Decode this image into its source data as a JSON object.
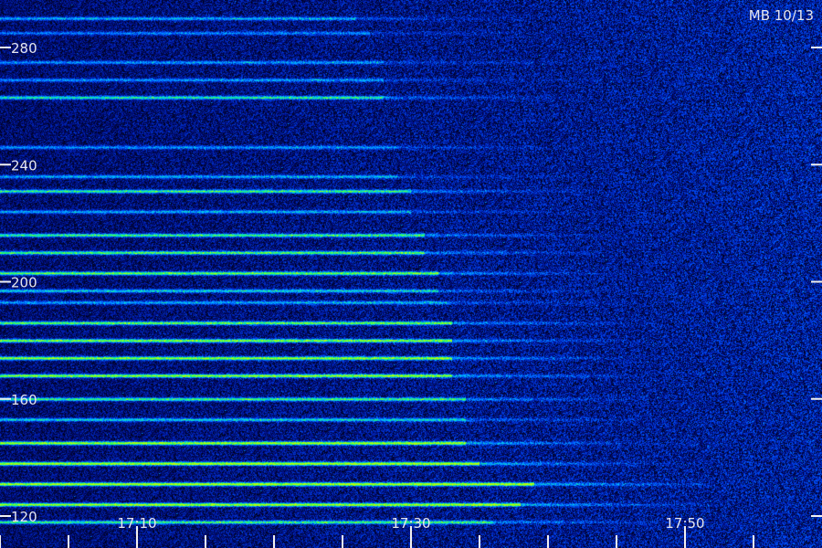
{
  "chart_data": {
    "type": "heatmap",
    "title": "MB 10/13",
    "xlabel": "",
    "ylabel": "",
    "x_tick_labels": [
      "17:10",
      "17:30",
      "17:50"
    ],
    "x_major_ticks_minutes_after_1700": [
      10,
      30,
      50
    ],
    "x_range_minutes_after_1700": [
      0,
      59
    ],
    "x_minor_tick_step_minutes": 5,
    "y_tick_labels": [
      "280",
      "240",
      "200",
      "160",
      "120"
    ],
    "y_ticks": [
      280,
      240,
      200,
      160,
      120
    ],
    "y_range": [
      115,
      297
    ],
    "grid": false,
    "colormap": [
      "#000010",
      "#001090",
      "#0050ff",
      "#00c0ff",
      "#20ff60",
      "#c0ff00"
    ],
    "bands": [
      {
        "y": 290,
        "intensity": 0.45,
        "end_minute": 26
      },
      {
        "y": 285,
        "intensity": 0.35,
        "end_minute": 27
      },
      {
        "y": 275,
        "intensity": 0.4,
        "end_minute": 28
      },
      {
        "y": 269,
        "intensity": 0.4,
        "end_minute": 28
      },
      {
        "y": 263,
        "intensity": 0.65,
        "end_minute": 28
      },
      {
        "y": 246,
        "intensity": 0.4,
        "end_minute": 29
      },
      {
        "y": 236,
        "intensity": 0.45,
        "end_minute": 29
      },
      {
        "y": 231,
        "intensity": 0.7,
        "end_minute": 30
      },
      {
        "y": 224,
        "intensity": 0.45,
        "end_minute": 30
      },
      {
        "y": 216,
        "intensity": 0.7,
        "end_minute": 31
      },
      {
        "y": 210,
        "intensity": 0.75,
        "end_minute": 31
      },
      {
        "y": 203,
        "intensity": 0.8,
        "end_minute": 32
      },
      {
        "y": 197,
        "intensity": 0.55,
        "end_minute": 32
      },
      {
        "y": 193,
        "intensity": 0.45,
        "end_minute": 33
      },
      {
        "y": 186,
        "intensity": 0.8,
        "end_minute": 33
      },
      {
        "y": 180,
        "intensity": 0.85,
        "end_minute": 33
      },
      {
        "y": 174,
        "intensity": 0.9,
        "end_minute": 33
      },
      {
        "y": 168,
        "intensity": 0.9,
        "end_minute": 33
      },
      {
        "y": 160,
        "intensity": 0.7,
        "end_minute": 34
      },
      {
        "y": 153,
        "intensity": 0.55,
        "end_minute": 34
      },
      {
        "y": 145,
        "intensity": 0.95,
        "end_minute": 34
      },
      {
        "y": 138,
        "intensity": 1.0,
        "end_minute": 35
      },
      {
        "y": 131,
        "intensity": 1.0,
        "end_minute": 39
      },
      {
        "y": 124,
        "intensity": 0.95,
        "end_minute": 38
      },
      {
        "y": 118,
        "intensity": 0.7,
        "end_minute": 36
      }
    ]
  }
}
